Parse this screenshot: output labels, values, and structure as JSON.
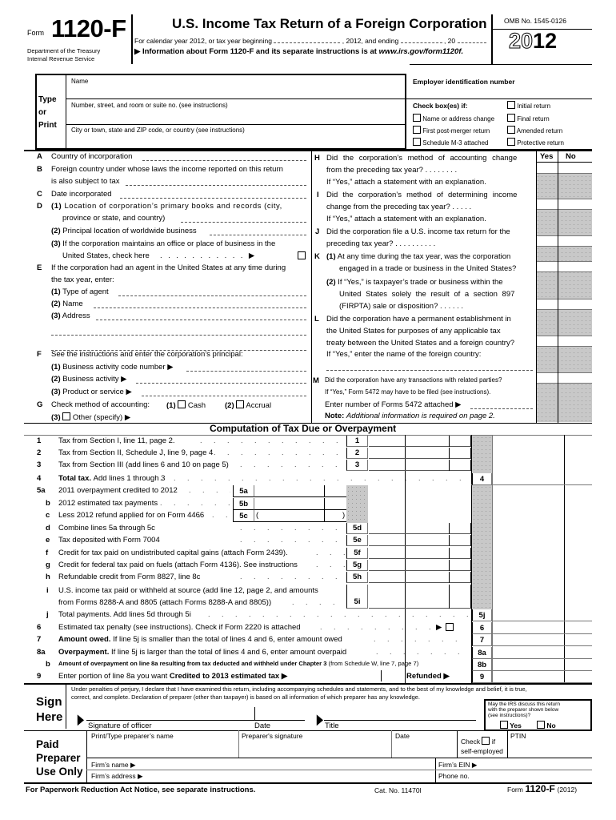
{
  "header": {
    "form_prefix": "Form",
    "form_number": "1120-F",
    "department": "Department of the Treasury",
    "service": "Internal Revenue Service",
    "title": "U.S. Income Tax Return of a Foreign Corporation",
    "calendar_line_1": "For calendar year 2012, or tax year beginning",
    "calendar_line_2": ", 2012, and ending",
    "calendar_line_3": ", 20",
    "info_line_prefix": "▶ Information about Form 1120-F and its separate instructions is at ",
    "info_url": "www.irs.gov/form1120f.",
    "omb": "OMB No. 1545-0126",
    "year_outline": "20",
    "year_bold": "12"
  },
  "identity": {
    "type_or_print": [
      "Type",
      "or",
      "Print"
    ],
    "name_label": "Name",
    "street_label": "Number, street, and room or suite no. (see instructions)",
    "city_label": "City or town, state and ZIP code, or country (see instructions)",
    "ein_label": "Employer identification number",
    "check_label": "Check box(es) if:",
    "checkboxes": [
      {
        "label": "Initial return",
        "checked": false
      },
      {
        "label": "Name or address change",
        "checked": false
      },
      {
        "label": "Final return",
        "checked": false
      },
      {
        "label": "First post-merger return",
        "checked": false
      },
      {
        "label": "Amended return",
        "checked": false
      },
      {
        "label": "Schedule M-3 attached",
        "checked": false
      },
      {
        "label": "Protective return",
        "checked": false
      }
    ]
  },
  "left_questions": {
    "A": {
      "letter": "A",
      "text": "Country of incorporation"
    },
    "B": {
      "letter": "B",
      "text1": "Foreign country under whose laws the income reported on this return",
      "text2": "is also subject to tax"
    },
    "C": {
      "letter": "C",
      "text": "Date incorporated"
    },
    "D": {
      "letter": "D",
      "d1_num": "(1)",
      "d1_text1": "Location of corporation’s primary books and records (city,",
      "d1_text2": "province or state, and country)",
      "d2_num": "(2)",
      "d2_text": "Principal location of worldwide business",
      "d3_num": "(3)",
      "d3_text1": "If the corporation maintains an office or place of business in the",
      "d3_text2": "United States, check here",
      "d3_dots": ". . . . . . . . . . . ▶"
    },
    "E": {
      "letter": "E",
      "text1": "If the corporation had an agent in the United States at any time during",
      "text2": "the tax year, enter:",
      "e1_num": "(1)",
      "e1_text": "Type of agent",
      "e2_num": "(2)",
      "e2_text": "Name",
      "e3_num": "(3)",
      "e3_text": "Address"
    },
    "F": {
      "letter": "F",
      "text": "See the instructions and enter the corporation’s principal:",
      "f1_num": "(1)",
      "f1_text": "Business activity code number ▶",
      "f2_num": "(2)",
      "f2_text": "Business activity ▶",
      "f3_num": "(3)",
      "f3_text": "Product or service ▶"
    },
    "G": {
      "letter": "G",
      "text": "Check method of accounting:",
      "opt1_num": "(1)",
      "opt1": "Cash",
      "opt2_num": "(2)",
      "opt2": "Accrual",
      "opt3_num": "(3)",
      "opt3": "Other (specify) ▶"
    }
  },
  "right_questions": {
    "yes": "Yes",
    "no": "No",
    "H": {
      "letter": "H",
      "l1": "Did the corporation’s method of accounting change",
      "l2": "from the preceding tax year? . . . . . . . .",
      "l3": "If “Yes,” attach a statement with an explanation."
    },
    "I": {
      "letter": "I",
      "l1": "Did the corporation’s method of determining income",
      "l2": "change from the preceding tax year? . . . . .",
      "l3": "If “Yes,” attach a statement with an explanation."
    },
    "J": {
      "letter": "J",
      "l1": "Did the corporation file a U.S. income tax return for the",
      "l2": "preceding tax year? . . . . . . . . . ."
    },
    "K": {
      "letter": "K",
      "k1_num": "(1)",
      "k1_l1": "At any time during the tax year, was the corporation",
      "k1_l2": "engaged in a trade or business in the United States?",
      "k2_num": "(2)",
      "k2_l1": "If “Yes,” is taxpayer’s trade or business within the",
      "k2_l2": "United States solely the result of a section 897",
      "k2_l3": "(FIRPTA) sale or disposition? . . . . . ."
    },
    "L": {
      "letter": "L",
      "l1": "Did the corporation have a permanent establishment in",
      "l2": "the United States for purposes of any applicable tax",
      "l3": "treaty between the United States and a foreign country?",
      "l4": "If “Yes,” enter the name of the foreign country:"
    },
    "M": {
      "letter": "M",
      "l1": "Did the corporation have any transactions with related parties?",
      "l2": "If “Yes,” Form 5472 may have to be filed (see instructions).",
      "l3": "Enter number of Forms 5472 attached ▶",
      "note_label": "Note:",
      "note_text": "Additional information is required on page 2."
    }
  },
  "computation": {
    "title": "Computation of Tax Due or Overpayment",
    "lines": [
      {
        "num": "1",
        "text": "Tax from Section I, line 11, page 2.",
        "box": "1",
        "bold": false
      },
      {
        "num": "2",
        "text": "Tax from Section II, Schedule J, line 9, page 4",
        "box": "2",
        "bold": false
      },
      {
        "num": "3",
        "text": "Tax from Section III (add lines 6 and 10 on page 5)",
        "box": "3",
        "bold": false
      },
      {
        "num": "4",
        "text_bold": "Total tax.",
        "text": "Add lines 1 through 3",
        "box": "4"
      },
      {
        "num": "5a",
        "text": "2011 overpayment credited to 2012",
        "box": "5a"
      },
      {
        "num": "b",
        "text": "2012 estimated tax payments",
        "box": "5b"
      },
      {
        "num": "c",
        "text": "Less 2012 refund applied for on Form 4466",
        "box": "5c",
        "paren_open": "(",
        "paren_close": ")"
      },
      {
        "num": "d",
        "text": "Combine lines 5a through 5c",
        "box": "5d"
      },
      {
        "num": "e",
        "text": "Tax deposited with Form 7004",
        "box": "5e"
      },
      {
        "num": "f",
        "text": "Credit for tax paid on undistributed capital gains (attach Form 2439).",
        "box": "5f"
      },
      {
        "num": "g",
        "text": "Credit for federal tax paid on fuels (attach Form 4136). See instructions",
        "box": "5g"
      },
      {
        "num": "h",
        "text": "Refundable credit from Form 8827, line 8c",
        "box": "5h"
      },
      {
        "num": "i",
        "text": "U.S. income tax paid or withheld at source (add line 12, page 2, and amounts",
        "text2": "from Forms 8288-A and 8805 (attach Forms 8288-A and 8805))",
        "box": "5i"
      },
      {
        "num": "j",
        "text": "Total payments. Add lines 5d through 5i",
        "box": "5j"
      },
      {
        "num": "6",
        "text": "Estimated tax penalty (see instructions). Check if Form 2220 is attached",
        "box": "6"
      },
      {
        "num": "7",
        "text_bold": "Amount owed.",
        "text": "If line 5j is smaller than the total of lines 4 and 6, enter amount owed",
        "box": "7"
      },
      {
        "num": "8a",
        "text_bold": "Overpayment.",
        "text": "If line 5j is larger than the total of lines 4 and 6, enter amount overpaid",
        "box": "8a"
      },
      {
        "num": "b",
        "text_bold": "Amount of overpayment on line 8a resulting from tax deducted and withheld under Chapter 3",
        "text": "(from Schedule W, line 7, page 7)",
        "box": "8b"
      },
      {
        "num": "9",
        "text": "Enter portion of line 8a you want ",
        "text_bold": "Credited to 2013 estimated tax ▶",
        "refunded": "Refunded ▶",
        "box": "9"
      }
    ]
  },
  "sign": {
    "heading": [
      "Sign",
      "Here"
    ],
    "perjury_1": "Under penalties of perjury, I declare that I have examined this return, including accompanying schedules and statements, and to the best of my knowledge and belief, it is true,",
    "perjury_2": "correct, and complete. Declaration of preparer (other than taxpayer) is based on all information of which preparer has any knowledge.",
    "signature_label": "Signature of officer",
    "date_label": "Date",
    "title_label": "Title",
    "discuss_text": "May the IRS discuss this return with the preparer shown below (see instructions)?",
    "yes": "Yes",
    "no": "No"
  },
  "preparer": {
    "heading": [
      "Paid",
      "Preparer",
      "Use Only"
    ],
    "name_label": "Print/Type preparer’s name",
    "signature_label": "Preparer's signature",
    "date_label": "Date",
    "check_label": "Check",
    "check_if": "if",
    "self_employed": "self-employed",
    "ptin_label": "PTIN",
    "firm_name_label": "Firm’s name ▶",
    "firm_ein_label": "Firm’s EIN ▶",
    "firm_address_label": "Firm’s address ▶",
    "phone_label": "Phone no."
  },
  "footer": {
    "paperwork": "For Paperwork Reduction Act Notice, see separate instructions.",
    "cat_no": "Cat. No. 11470I",
    "form_prefix": "Form",
    "form_number": "1120-F",
    "form_year": "(2012)"
  }
}
